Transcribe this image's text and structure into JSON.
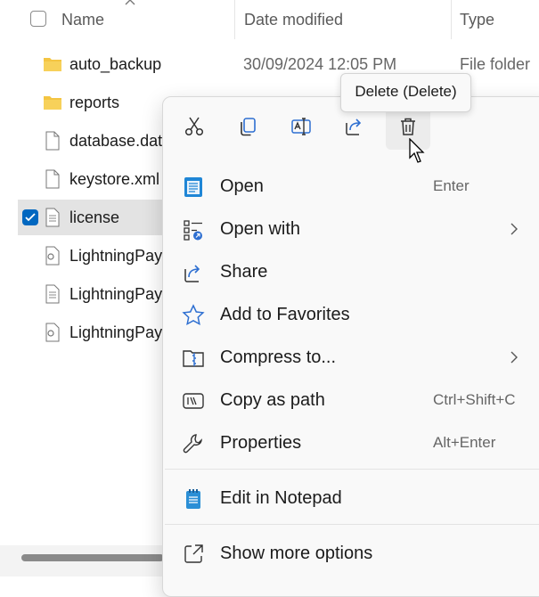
{
  "columns": {
    "name": "Name",
    "date_modified": "Date modified",
    "type": "Type"
  },
  "files": [
    {
      "name": "auto_backup",
      "date": "30/09/2024 12:05 PM",
      "type": "File folder",
      "icon": "folder-icon"
    },
    {
      "name": "reports",
      "date": "",
      "type": "",
      "icon": "folder-icon"
    },
    {
      "name": "database.dat",
      "date": "",
      "type": "",
      "icon": "file-icon"
    },
    {
      "name": "keystore.xml",
      "date": "",
      "type": "",
      "icon": "file-icon"
    },
    {
      "name": "license",
      "date": "",
      "type": "",
      "icon": "text-file-icon",
      "selected": true
    },
    {
      "name": "LightningPayr",
      "date": "",
      "type": "",
      "icon": "config-file-icon"
    },
    {
      "name": "LightningPayr",
      "date": "",
      "type": "",
      "icon": "text-file-icon"
    },
    {
      "name": "LightningPayr",
      "date": "",
      "type": "",
      "icon": "config-file-icon"
    }
  ],
  "tooltip": "Delete (Delete)",
  "quick_actions": [
    "cut-icon",
    "copy-icon",
    "rename-icon",
    "share-icon",
    "delete-icon"
  ],
  "menu": {
    "open": {
      "label": "Open",
      "shortcut": "Enter"
    },
    "open_with": {
      "label": "Open with"
    },
    "share": {
      "label": "Share"
    },
    "favorites": {
      "label": "Add to Favorites"
    },
    "compress": {
      "label": "Compress to..."
    },
    "copy_path": {
      "label": "Copy as path",
      "shortcut": "Ctrl+Shift+C"
    },
    "properties": {
      "label": "Properties",
      "shortcut": "Alt+Enter"
    },
    "notepad": {
      "label": "Edit in Notepad"
    },
    "more": {
      "label": "Show more options"
    }
  },
  "colors": {
    "accent": "#0067c0",
    "folder": "#f4c542",
    "selected_row": "#e3e3e3"
  }
}
